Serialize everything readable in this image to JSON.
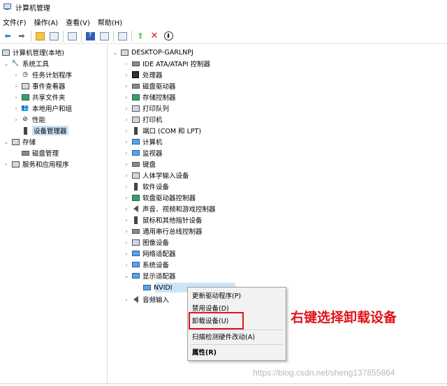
{
  "window": {
    "title": "计算机管理"
  },
  "menu": [
    "文件(F)",
    "操作(A)",
    "查看(V)",
    "帮助(H)"
  ],
  "left_tree": [
    {
      "label": "计算机管理(本地)",
      "icon": "computer-mgmt-icon"
    },
    {
      "label": "系统工具",
      "icon": "tools-icon"
    },
    {
      "label": "任务计划程序",
      "icon": "clock-icon"
    },
    {
      "label": "事件查看器",
      "icon": "event-viewer-icon"
    },
    {
      "label": "共享文件夹",
      "icon": "shared-folder-icon"
    },
    {
      "label": "本地用户和组",
      "icon": "users-icon"
    },
    {
      "label": "性能",
      "icon": "performance-icon"
    },
    {
      "label": "设备管理器",
      "icon": "device-manager-icon"
    },
    {
      "label": "存储",
      "icon": "storage-icon"
    },
    {
      "label": "磁盘管理",
      "icon": "disk-icon"
    },
    {
      "label": "服务和应用程序",
      "icon": "services-icon"
    }
  ],
  "right_tree": {
    "root": "DESKTOP-GARLNPJ",
    "categories": [
      "IDE ATA/ATAPI 控制器",
      "处理器",
      "磁盘驱动器",
      "存储控制器",
      "打印队列",
      "打印机",
      "端口 (COM 和 LPT)",
      "计算机",
      "监视器",
      "键盘",
      "人体学输入设备",
      "软件设备",
      "软盘驱动器控制器",
      "声音、视频和游戏控制器",
      "鼠标和其他指针设备",
      "通用串行总线控制器",
      "图像设备",
      "网络适配器",
      "系统设备",
      "显示适配器"
    ],
    "child_label": "NVIDI",
    "after_child": "音频输入"
  },
  "context_menu": {
    "update_driver": "更新驱动程序(P)",
    "disable": "禁用设备(D)",
    "uninstall": "卸载设备(U)",
    "scan": "扫描检测硬件改动(A)",
    "properties": "属性(R)"
  },
  "annotation": "右键选择卸载设备",
  "watermark": "https://blog.csdn.net/sheng137855864"
}
